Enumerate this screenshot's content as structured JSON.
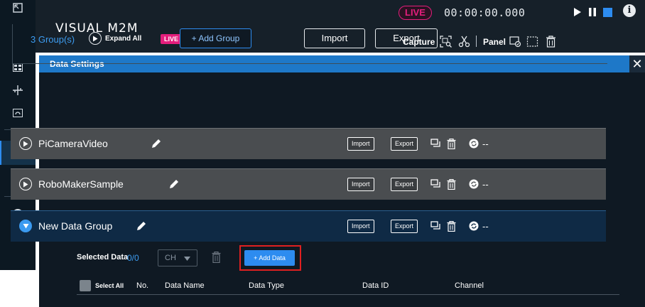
{
  "app": {
    "logo_text": "VISUAL M2M",
    "live_chip": "LIVE"
  },
  "player": {
    "live_label": "LIVE",
    "timecode": "00:00:00.000"
  },
  "toolbar": {
    "capture_label": "Capture",
    "panel_label": "Panel"
  },
  "panel": {
    "title": "Data Settings",
    "group_count": "3 Group(s)",
    "expand_all_label": "Expand All",
    "add_group_label": "+ Add Group",
    "import_label": "Import",
    "export_label": "Export"
  },
  "groups": [
    {
      "name": "PiCameraVideo",
      "import_label": "Import",
      "export_label": "Export",
      "status": "--",
      "expanded": false
    },
    {
      "name": "RoboMakerSample",
      "import_label": "Import",
      "export_label": "Export",
      "status": "--",
      "expanded": false
    },
    {
      "name": "New Data Group",
      "import_label": "Import",
      "export_label": "Export",
      "status": "--",
      "expanded": true
    }
  ],
  "data_section": {
    "selected_label": "Selected Data",
    "selected_count": "0/0",
    "ch_select_value": "CH",
    "add_data_label": "+ Add Data",
    "columns": [
      "Select All",
      "No.",
      "Data Name",
      "Data Type",
      "Data ID",
      "Channel"
    ]
  },
  "colors": {
    "accent": "#2d8cf0",
    "live": "#e41e7c",
    "highlight": "#e02020",
    "panel_bg": "#0f1923"
  },
  "icons": [
    "fullscreen-icon",
    "dashboard-icon",
    "network-icon",
    "camera-icon",
    "list-icon",
    "cloud-upload-icon",
    "user-icon",
    "play-icon",
    "pause-icon",
    "stop-icon",
    "info-icon",
    "capture-icon",
    "scissors-icon",
    "panel-add-icon",
    "panel-select-icon",
    "trash-icon",
    "pencil-icon",
    "copy-icon",
    "sync-icon"
  ]
}
